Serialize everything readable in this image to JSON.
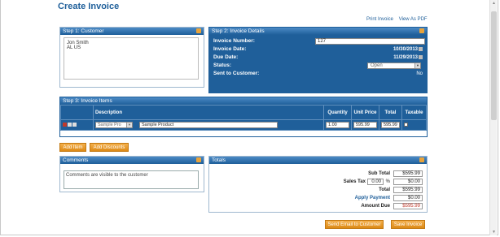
{
  "page": {
    "title": "Create Invoice"
  },
  "top_links": {
    "print": "Print Invoice",
    "pdf": "View As PDF"
  },
  "customer": {
    "header": "Step 1: Customer",
    "name": "Jon Smith",
    "location": "AL US"
  },
  "details": {
    "header": "Step 2: Invoice Details",
    "invoice_number_label": "Invoice Number:",
    "invoice_number_value": "127",
    "invoice_date_label": "Invoice Date:",
    "invoice_date_value": "10/30/2013",
    "due_date_label": "Due Date:",
    "due_date_value": "11/29/2013",
    "status_label": "Status:",
    "status_value": "Open",
    "sent_label": "Sent to Customer:",
    "sent_value": "No"
  },
  "items": {
    "header": "Step 3: Invoice Items",
    "columns": [
      "Description",
      "Quantity",
      "Unit Price",
      "Total",
      "Taxable"
    ],
    "row": {
      "product_select": "Sample Pro",
      "description": "Sample Product",
      "quantity": "1.00",
      "unit_price": "595.99",
      "total": "595.99"
    },
    "add_item": "Add Item",
    "add_discounts": "Add Discounts"
  },
  "comments": {
    "header": "Comments",
    "text": "Comments are visible to the customer"
  },
  "totals": {
    "header": "Totals",
    "sub_total_label": "Sub Total",
    "sub_total_value": "$595.99",
    "sales_tax_label": "Sales Tax",
    "sales_tax_rate": "0.00",
    "sales_tax_pct": "%",
    "sales_tax_value": "$0.00",
    "total_label": "Total",
    "total_value": "$595.99",
    "apply_payment_label": "Apply Payment",
    "apply_payment_value": "$0.00",
    "amount_due_label": "Amount Due",
    "amount_due_value": "$595.99"
  },
  "actions": {
    "send_email": "Send Email to Customer",
    "save_invoice": "Save Invoice"
  },
  "colors": {
    "primary": "#1f5f9a",
    "accent": "#e8a33b",
    "due": "#c0392b"
  }
}
